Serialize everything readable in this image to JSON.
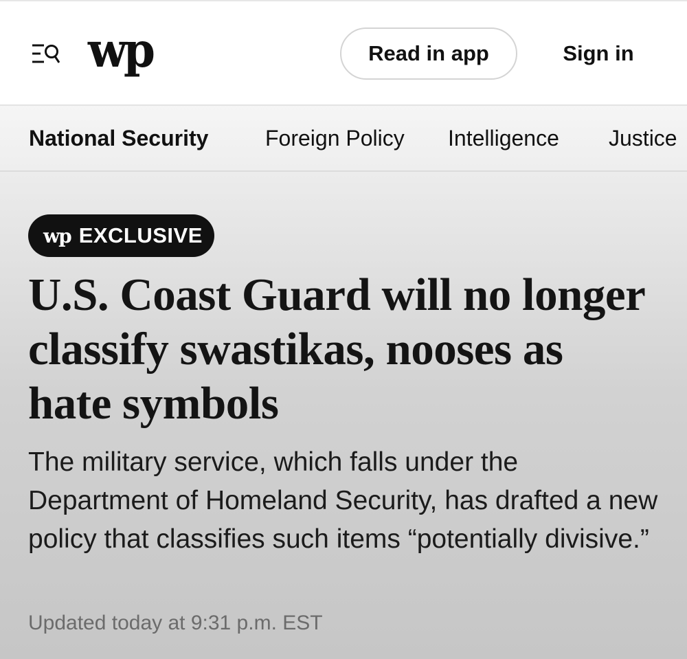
{
  "header": {
    "menu_icon": "menu-search-icon",
    "logo": "wp",
    "read_in_app_label": "Read in app",
    "sign_in_label": "Sign in"
  },
  "section_nav": {
    "items": [
      {
        "label": "National Security",
        "active": true
      },
      {
        "label": "Foreign Policy",
        "active": false
      },
      {
        "label": "Intelligence",
        "active": false
      },
      {
        "label": "Justice",
        "active": false
      }
    ]
  },
  "article": {
    "badge_logo": "wp",
    "badge_label": "EXCLUSIVE",
    "headline": "U.S. Coast Guard will no longer classify swastikas, nooses as hate symbols",
    "dek": "The military service, which falls under the Department of Homeland Security, has drafted a new policy that classifies such items “potentially divisive.”",
    "timestamp": "Updated today at 9:31 p.m. EST"
  },
  "colors": {
    "text": "#111111",
    "badge_bg": "#111111",
    "timestamp": "#6b6b6b",
    "hero_gradient_top": "#ececec",
    "hero_gradient_bottom": "#c6c6c6"
  }
}
